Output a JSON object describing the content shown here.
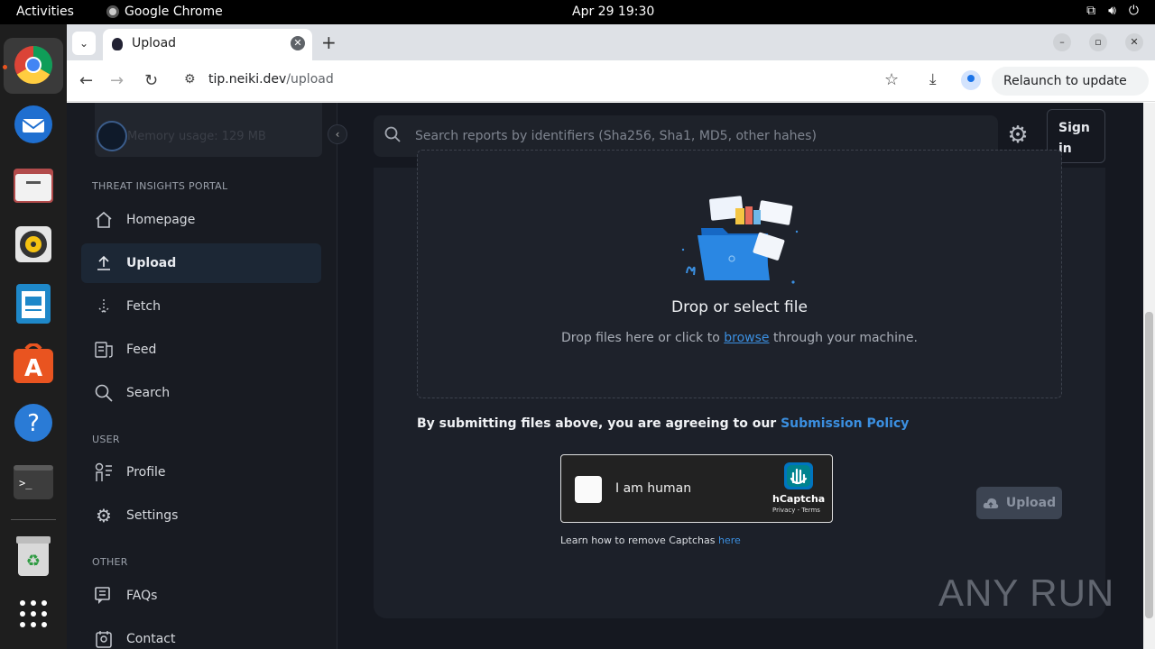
{
  "topbar": {
    "activities": "Activities",
    "app_name": "Google Chrome",
    "datetime": "Apr 29  19:30"
  },
  "dock": {
    "items": [
      "chrome",
      "thunderbird",
      "files",
      "rhythmbox",
      "writer",
      "app-center",
      "help",
      "terminal",
      "trash",
      "show-apps"
    ]
  },
  "browser": {
    "tab_title": "Upload",
    "url_host": "tip.neiki.dev",
    "url_path": "/upload",
    "relaunch_label": "Relaunch to update"
  },
  "sidebar": {
    "memory_text": "Memory usage: 129 MB",
    "sections": [
      {
        "label": "THREAT INSIGHTS PORTAL"
      },
      {
        "label": "USER"
      },
      {
        "label": "OTHER"
      }
    ],
    "items": [
      {
        "label": "Homepage",
        "icon": "home-icon",
        "active": false
      },
      {
        "label": "Upload",
        "icon": "upload-icon",
        "active": true
      },
      {
        "label": "Fetch",
        "icon": "download-arrow-icon",
        "active": false
      },
      {
        "label": "Feed",
        "icon": "feed-icon",
        "active": false
      },
      {
        "label": "Search",
        "icon": "search-icon",
        "active": false
      },
      {
        "label": "Profile",
        "icon": "profile-icon",
        "active": false
      },
      {
        "label": "Settings",
        "icon": "gear-icon",
        "active": false
      },
      {
        "label": "FAQs",
        "icon": "faq-icon",
        "active": false
      },
      {
        "label": "Contact",
        "icon": "contact-icon",
        "active": false
      }
    ]
  },
  "header": {
    "search_placeholder": "Search reports by identifiers (Sha256, Sha1, MD5, other hahes)",
    "signin_line1": "Sign",
    "signin_line2": "in"
  },
  "upload": {
    "drop_title": "Drop or select file",
    "drop_sub_before": "Drop files here or click to ",
    "drop_sub_link": "browse",
    "drop_sub_after": " through your machine.",
    "policy_text": "By submitting files above, you are agreeing to our ",
    "policy_link": "Submission Policy",
    "captcha_label": "I am human",
    "captcha_brand": "hCaptcha",
    "captcha_terms": "Privacy - Terms",
    "learn_text": "Learn how to remove Captchas ",
    "learn_link": "here",
    "upload_button": "Upload"
  },
  "watermark": "ANY RUN",
  "colors": {
    "accent": "#3b8fe0",
    "page_bg": "#151820",
    "sidebar_bg": "#181b22",
    "active_item_bg": "#1c2735"
  }
}
